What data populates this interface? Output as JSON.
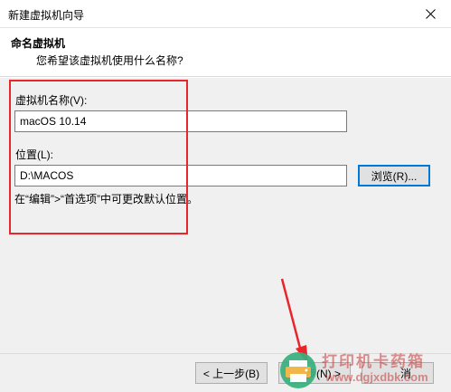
{
  "window": {
    "title": "新建虚拟机向导"
  },
  "header": {
    "title": "命名虚拟机",
    "subtitle": "您希望该虚拟机使用什么名称?"
  },
  "form": {
    "name_label": "虚拟机名称(V):",
    "name_value": "macOS 10.14",
    "location_label": "位置(L):",
    "location_value": "D:\\MACOS",
    "browse_label": "浏览(R)...",
    "hint": "在“编辑”>“首选项”中可更改默认位置。"
  },
  "footer": {
    "back_label": "< 上一步(B)",
    "next_label": "步(N) >",
    "cancel_label": "消"
  },
  "watermark": {
    "line1": "打印机卡药箱",
    "line2": "www.dgjxdbk.com"
  },
  "colors": {
    "highlight": "#e8262b",
    "arrow": "#e8262b"
  }
}
